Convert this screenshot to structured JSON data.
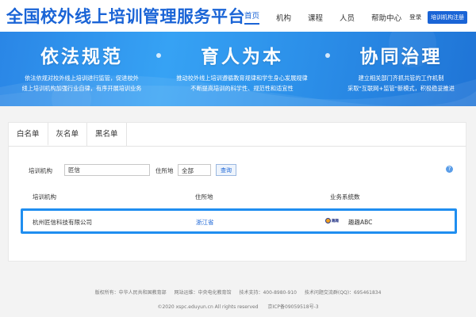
{
  "header": {
    "site_title": "全国校外线上培训管理服务平台",
    "nav": [
      "首页",
      "机构",
      "课程",
      "人员",
      "帮助中心"
    ],
    "login_label": "登录",
    "register_label": "培训机构注册",
    "accent_color": "#1a64d6"
  },
  "banner": {
    "pillars": [
      {
        "title": "依法规范",
        "desc_line1": "依法依规对校外线上培训进行监管，促进校外",
        "desc_line2": "线上培训机构加强行业自律，有序开展培训业务"
      },
      {
        "title": "育人为本",
        "desc_line1": "推动校外线上培训遵循教育规律和学生身心发展规律",
        "desc_line2": "不断提高培训的科学性、规范性和适宜性"
      },
      {
        "title": "协同治理",
        "desc_line1": "建立相关部门齐抓共管的工作机制",
        "desc_line2": "采取\"互联网+监管\"新模式，积极稳妥推进"
      }
    ]
  },
  "tabs": [
    "白名单",
    "灰名单",
    "黑名单"
  ],
  "active_tab": "白名单",
  "filter": {
    "org_label": "培训机构",
    "org_value": "匠信",
    "location_label": "住所地",
    "location_value": "全部",
    "query_label": "查询",
    "help_icon": "question-icon"
  },
  "table": {
    "headers": [
      "培训机构",
      "住所地",
      "业务系统数"
    ],
    "rows": [
      {
        "org": "杭州匠信科技有限公司",
        "location": "浙江省",
        "system_name": "趣趣ABC",
        "system_icon": "qqabc-logo-icon"
      }
    ],
    "highlight_color": "#1f8ef0"
  },
  "footer": {
    "line1": [
      "版权所有：中华人民共和国教育部",
      "网站运维：中央电化教育馆",
      "技术支持：400-8980-910",
      "技术问题交流群(QQ)：695461834"
    ],
    "line2": [
      "©2020 xspc.eduyun.cn All rights reserved",
      "京ICP备09059518号-3"
    ]
  }
}
